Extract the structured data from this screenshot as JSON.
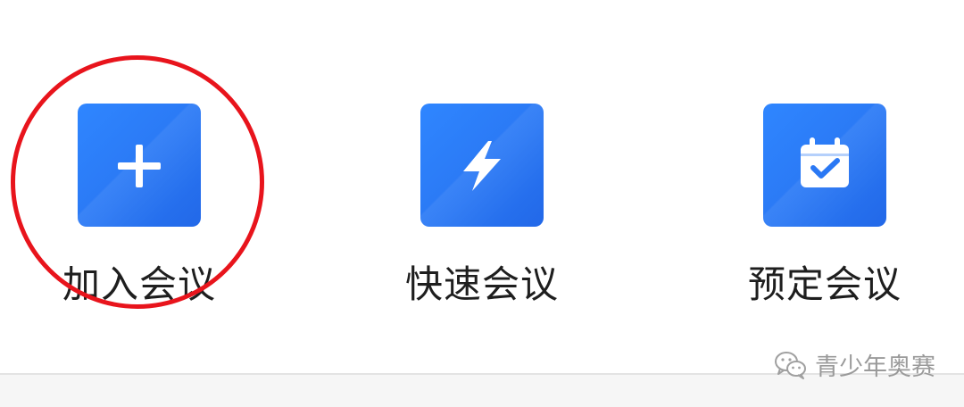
{
  "actions": [
    {
      "id": "join",
      "label": "加入会议",
      "icon": "plus-icon"
    },
    {
      "id": "quick",
      "label": "快速会议",
      "icon": "lightning-bolt-icon"
    },
    {
      "id": "schedule",
      "label": "预定会议",
      "icon": "calendar-check-icon"
    }
  ],
  "watermark": {
    "text": "青少年奥赛",
    "icon": "wechat-icon"
  },
  "colors": {
    "tile_blue": "#2a78f4",
    "highlight_red": "#e8141c",
    "label_text": "#1e1e1e",
    "watermark_text": "#9a9a9a"
  }
}
